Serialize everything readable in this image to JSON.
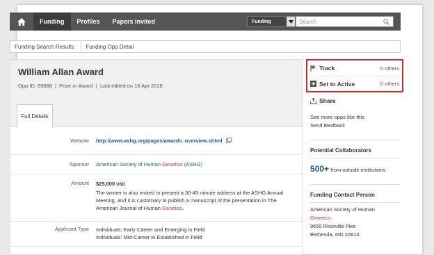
{
  "nav": {
    "items": [
      {
        "label": "Funding",
        "active": true
      },
      {
        "label": "Profiles",
        "active": false
      },
      {
        "label": "Papers Invited",
        "active": false
      }
    ],
    "search_scope": "Funding",
    "search_placeholder": "Search"
  },
  "breadcrumb": [
    "Funding Search Results",
    "Funding Opp Detail"
  ],
  "opp": {
    "title": "William Allan Award",
    "meta": "Opp ID: 69888  |  Prize or Award  |  Last edited on 16 Apr 2018",
    "tab": "Full Details",
    "website_label": "Website",
    "website": "http://www.ashg.org/pages/awards_overview.shtml",
    "sponsor_label": "Sponsor",
    "sponsor_a": "American Society of Human ",
    "sponsor_b": "Genetics",
    "sponsor_c": " (ASHG)",
    "amount_label": "Amount",
    "amount": "$25,000",
    "amount_unit": "USD",
    "amount_text": "The winner is also invited to present a 30-45 minute address at the ASHG Annual Meeting, and it is customary to publish a manuscript of the presentation in The American Journal of Human ",
    "amount_red": "Genetics",
    "applicant_label": "Applicant Type",
    "applicant_1": "Individuals: Early Career and Emerging in Field",
    "applicant_2": "Individuals: Mid-Career to Established in Field"
  },
  "side": {
    "track": "Track",
    "track_others": "0 others",
    "active": "Set to Active",
    "active_others": "0 others",
    "share": "Share",
    "see_more": "See more opps like this",
    "feedback": "Send feedback",
    "collab_title": "Potential Collaborators",
    "collab_count": "500+",
    "collab_text": "from outside institutions",
    "contact_title": "Funding Contact Person",
    "contact_1": "American Society of Human",
    "contact_2": "Genetics",
    "contact_3": "9650 Rockville Pike",
    "contact_4": "Bethesda, MD 20814"
  }
}
